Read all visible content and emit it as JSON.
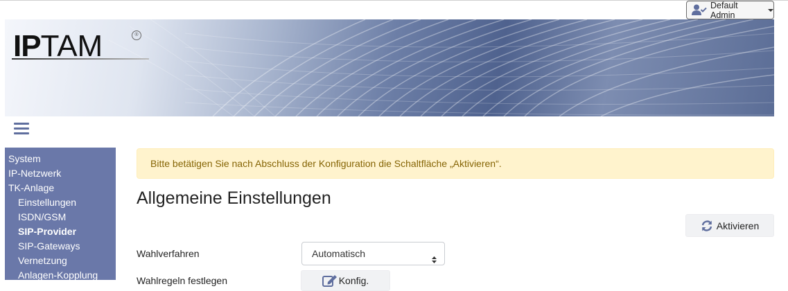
{
  "header": {
    "user_menu": {
      "label": "Default Admin",
      "icon": "user-check-icon"
    },
    "logo": {
      "text_bold": "IP",
      "text_regular": "TAM",
      "registered": "®"
    }
  },
  "sidebar": {
    "items": [
      {
        "label": "System",
        "level": 0
      },
      {
        "label": "IP-Netzwerk",
        "level": 0
      },
      {
        "label": "TK-Anlage",
        "level": 0
      },
      {
        "label": "Einstellungen",
        "level": 1
      },
      {
        "label": "ISDN/GSM",
        "level": 1
      },
      {
        "label": "SIP-Provider",
        "level": 1,
        "active": true
      },
      {
        "label": "SIP-Gateways",
        "level": 1
      },
      {
        "label": "Vernetzung",
        "level": 1
      },
      {
        "label": "Anlagen-Kopplung",
        "level": 1
      }
    ]
  },
  "main": {
    "alert": "Bitte betätigen Sie nach Abschluss der Konfiguration die Schaltfläche „Aktivieren“.",
    "title": "Allgemeine Einstellungen",
    "activate_label": "Aktivieren",
    "fields": {
      "dial_method_label": "Wahlverfahren",
      "dial_method_value": "Automatisch",
      "dial_rules_label": "Wahlregeln festlegen",
      "config_label": "Konfig."
    }
  },
  "colors": {
    "sidebar_bg": "#6a78a9",
    "alert_bg": "#fff3cd",
    "alert_text": "#856404",
    "accent_icon": "#5f6e9e"
  }
}
